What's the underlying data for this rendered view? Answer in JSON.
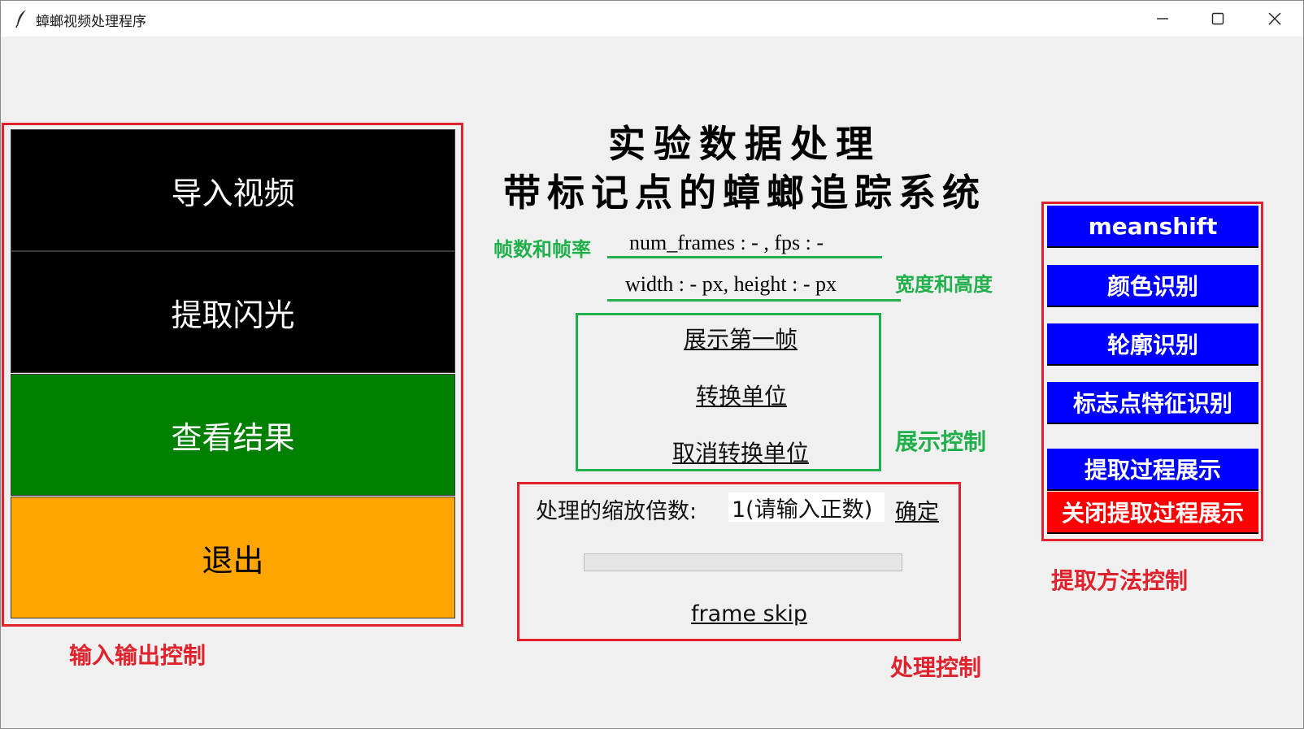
{
  "window": {
    "title": "蟑螂视频处理程序",
    "controls": {
      "minimize": "minimize",
      "maximize": "maximize",
      "close": "close"
    }
  },
  "io_panel": {
    "buttons": [
      {
        "label": "导入视频",
        "bg": "#000000",
        "fg": "#ffffff"
      },
      {
        "label": "提取闪光",
        "bg": "#000000",
        "fg": "#ffffff"
      },
      {
        "label": "查看结果",
        "bg": "#008000",
        "fg": "#ffffff"
      },
      {
        "label": "退出",
        "bg": "#ffa500",
        "fg": "#000000"
      }
    ],
    "annotation": "输入输出控制"
  },
  "header": {
    "title_line1": "实验数据处理",
    "title_line2": "带标记点的蟑螂追踪系统"
  },
  "video_info": {
    "frames_annotation": "帧数和帧率",
    "frames_text": "num_frames : - , fps : -",
    "size_text": "width : - px, height : - px",
    "size_annotation": "宽度和高度"
  },
  "display_panel": {
    "buttons": [
      "展示第一帧",
      "转换单位",
      "取消转换单位"
    ],
    "annotation": "展示控制"
  },
  "process_panel": {
    "scale_label": "处理的缩放倍数:",
    "scale_value": "1(请输入正数)",
    "confirm_label": "确定",
    "progress": 0,
    "frame_skip_label": "frame skip",
    "annotation": "处理控制"
  },
  "method_panel": {
    "buttons": [
      {
        "label": "meanshift",
        "bg": "#0000ff"
      },
      {
        "label": "颜色识别",
        "bg": "#0000ff"
      },
      {
        "label": "轮廓识别",
        "bg": "#0000ff"
      },
      {
        "label": "标志点特征识别",
        "bg": "#0000ff"
      },
      {
        "label": "提取过程展示",
        "bg": "#0000ff"
      },
      {
        "label": "关闭提取过程展示",
        "bg": "#ff0000"
      }
    ],
    "annotation": "提取方法控制"
  },
  "colors": {
    "annotation_red": "#e0222c",
    "annotation_green": "#22b04c"
  }
}
